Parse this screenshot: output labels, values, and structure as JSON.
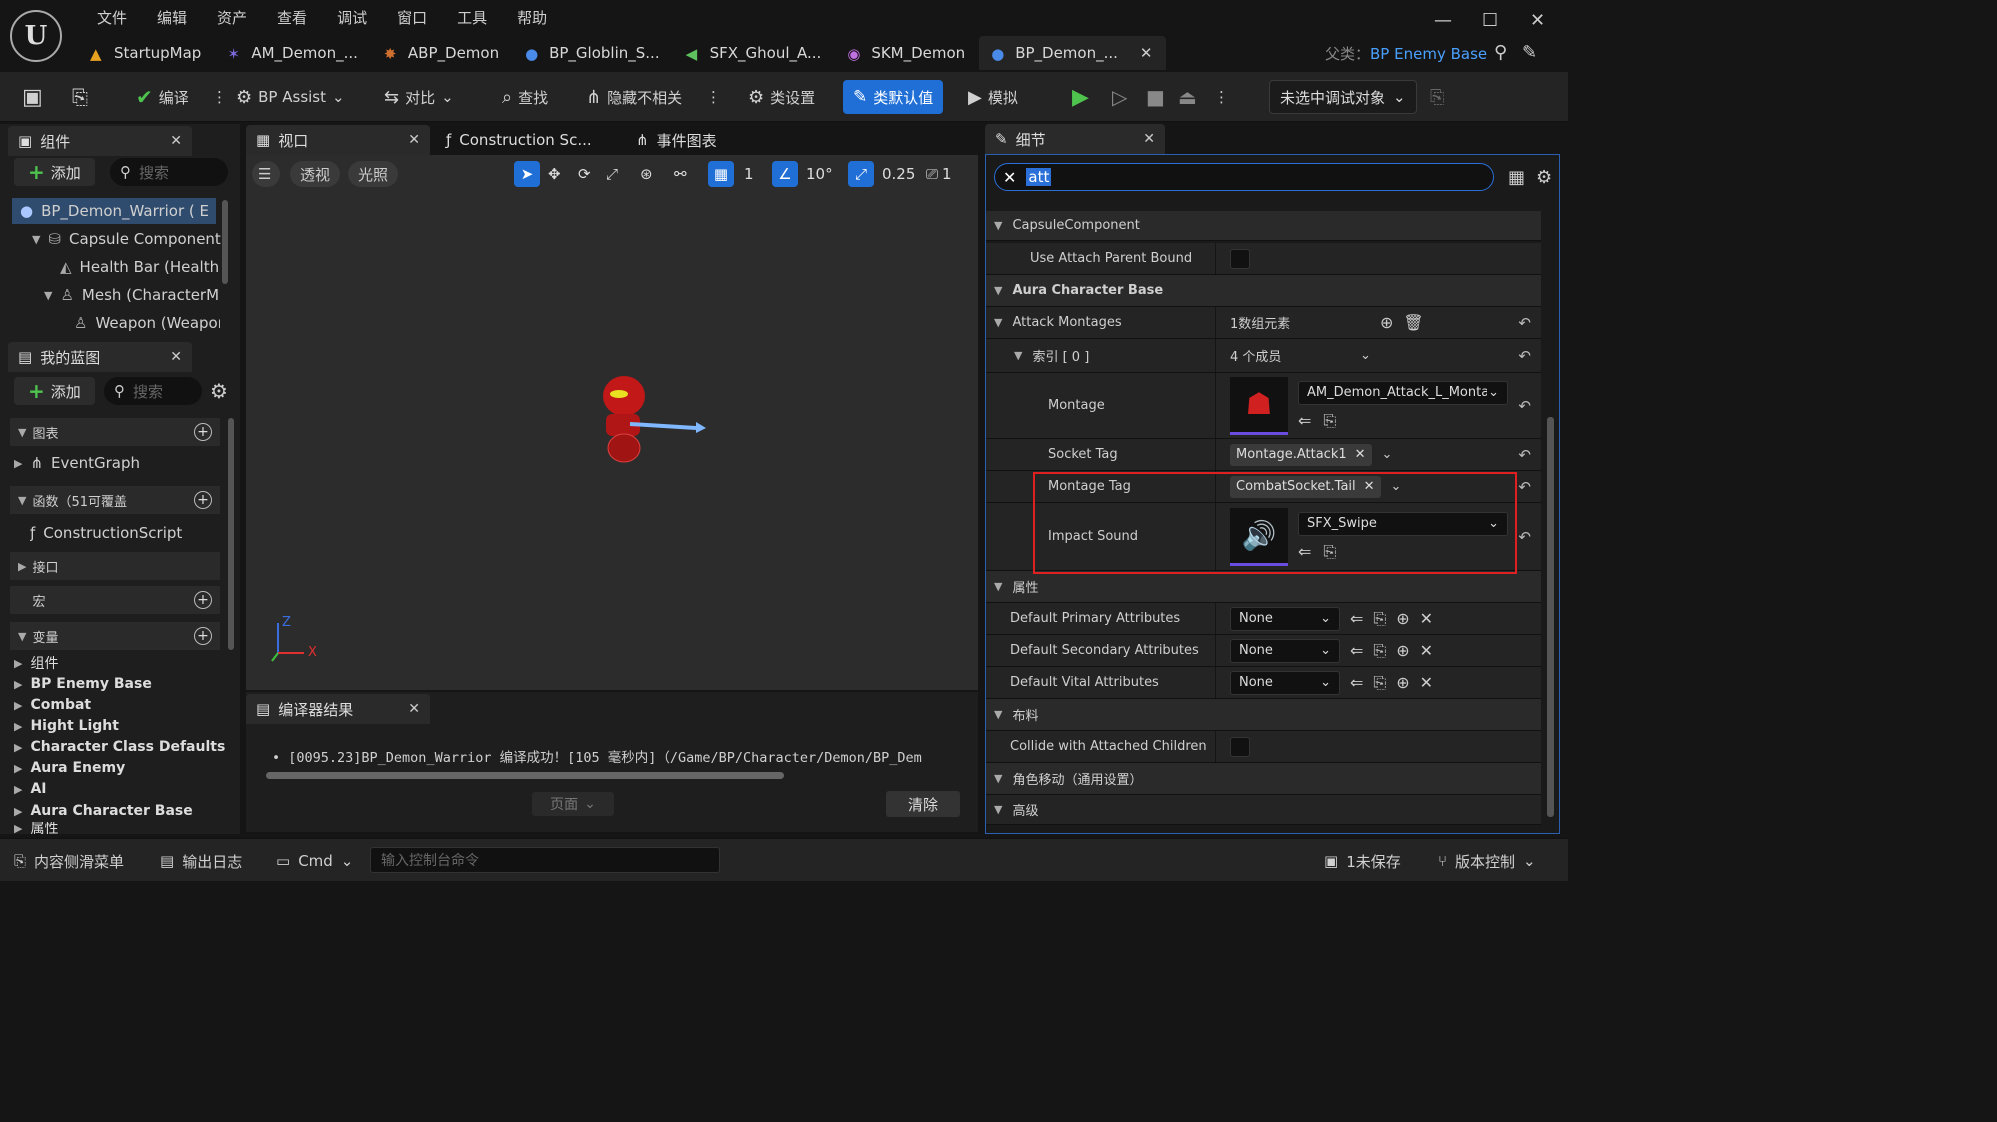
{
  "menu": [
    "文件",
    "编辑",
    "资产",
    "查看",
    "调试",
    "窗口",
    "工具",
    "帮助"
  ],
  "tabs": [
    {
      "label": "StartupMap"
    },
    {
      "label": "AM_Demon_..."
    },
    {
      "label": "ABP_Demon"
    },
    {
      "label": "BP_Globlin_S..."
    },
    {
      "label": "SFX_Ghoul_A..."
    },
    {
      "label": "SKM_Demon"
    },
    {
      "label": "BP_Demon_..."
    }
  ],
  "parent": {
    "prefix": "父类：",
    "value": "BP Enemy Base"
  },
  "toolbar": {
    "compile": "编译",
    "bp_assist": "BP Assist",
    "diff": "对比",
    "find": "查找",
    "hide_unrelated": "隐藏不相关",
    "class_settings": "类设置",
    "class_defaults": "类默认值",
    "simulate": "模拟",
    "debug_target": "未选中调试对象"
  },
  "components": {
    "tab": "组件",
    "add": "添加",
    "search_placeholder": "搜索",
    "tree": [
      {
        "label": "BP_Demon_Warrior  ( E"
      },
      {
        "label": "Capsule Component"
      },
      {
        "label": "Health Bar (Health"
      },
      {
        "label": "Mesh (CharacterM"
      },
      {
        "label": "Weapon (Weapor"
      }
    ]
  },
  "my_blueprint": {
    "tab": "我的蓝图",
    "add": "添加",
    "search_placeholder": "搜索",
    "graphs": "图表",
    "event_graph": "EventGraph",
    "functions": "函数（51可覆盖",
    "construction_script": "ConstructionScript",
    "interfaces": "接口",
    "macros": "宏",
    "variables": "变量",
    "var_groups": [
      "组件",
      "BP Enemy Base",
      "Combat",
      "Hight Light",
      "Character Class Defaults",
      "Aura Enemy",
      "AI",
      "Aura Character Base",
      "属性"
    ]
  },
  "center_tabs": {
    "viewport": "视口",
    "construction": "Construction Sc...",
    "event_graph": "事件图表"
  },
  "viewport": {
    "perspective": "透视",
    "lit": "光照",
    "grid_value": "1",
    "angle_value": "10°",
    "scale_value": "0.25",
    "camera_value": "1",
    "axis_z": "Z",
    "axis_x": "X"
  },
  "compiler": {
    "tab": "编译器结果",
    "message": "[0095.23]BP_Demon_Warrior 编译成功！[105 毫秒内]（/Game/BP/Character/Demon/BP_Dem",
    "page": "页面",
    "clear": "清除"
  },
  "details": {
    "tab": "细节",
    "search_value": "att",
    "rows": {
      "capsule": "CapsuleComponent",
      "use_attach": "Use Attach Parent Bound",
      "aura_base": "Aura Character Base",
      "attack_montages": "Attack Montages",
      "attack_count": "1数组元素",
      "index0": "索引 [ 0 ]",
      "members": "4 个成员",
      "montage": "Montage",
      "montage_value": "AM_Demon_Attack_L_Montage",
      "socket_tag": "Socket Tag",
      "socket_value": "Montage.Attack1",
      "montage_tag": "Montage Tag",
      "montage_tag_value": "CombatSocket.Tail",
      "impact_sound": "Impact Sound",
      "impact_value": "SFX_Swipe",
      "attributes": "属性",
      "primary": "Default Primary Attributes",
      "secondary": "Default Secondary Attributes",
      "vital": "Default Vital Attributes",
      "none": "None",
      "cloth": "布料",
      "collide": "Collide with Attached Children",
      "movement": "角色移动（通用设置）",
      "advanced": "高级"
    }
  },
  "statusbar": {
    "content_drawer": "内容侧滑菜单",
    "output_log": "输出日志",
    "cmd": "Cmd",
    "console_placeholder": "输入控制台命令",
    "unsaved": "1未保存",
    "source_control": "版本控制"
  },
  "colors": {
    "accent": "#1f6fd6",
    "highlight": "#e02020",
    "link": "#4aa0ff"
  }
}
